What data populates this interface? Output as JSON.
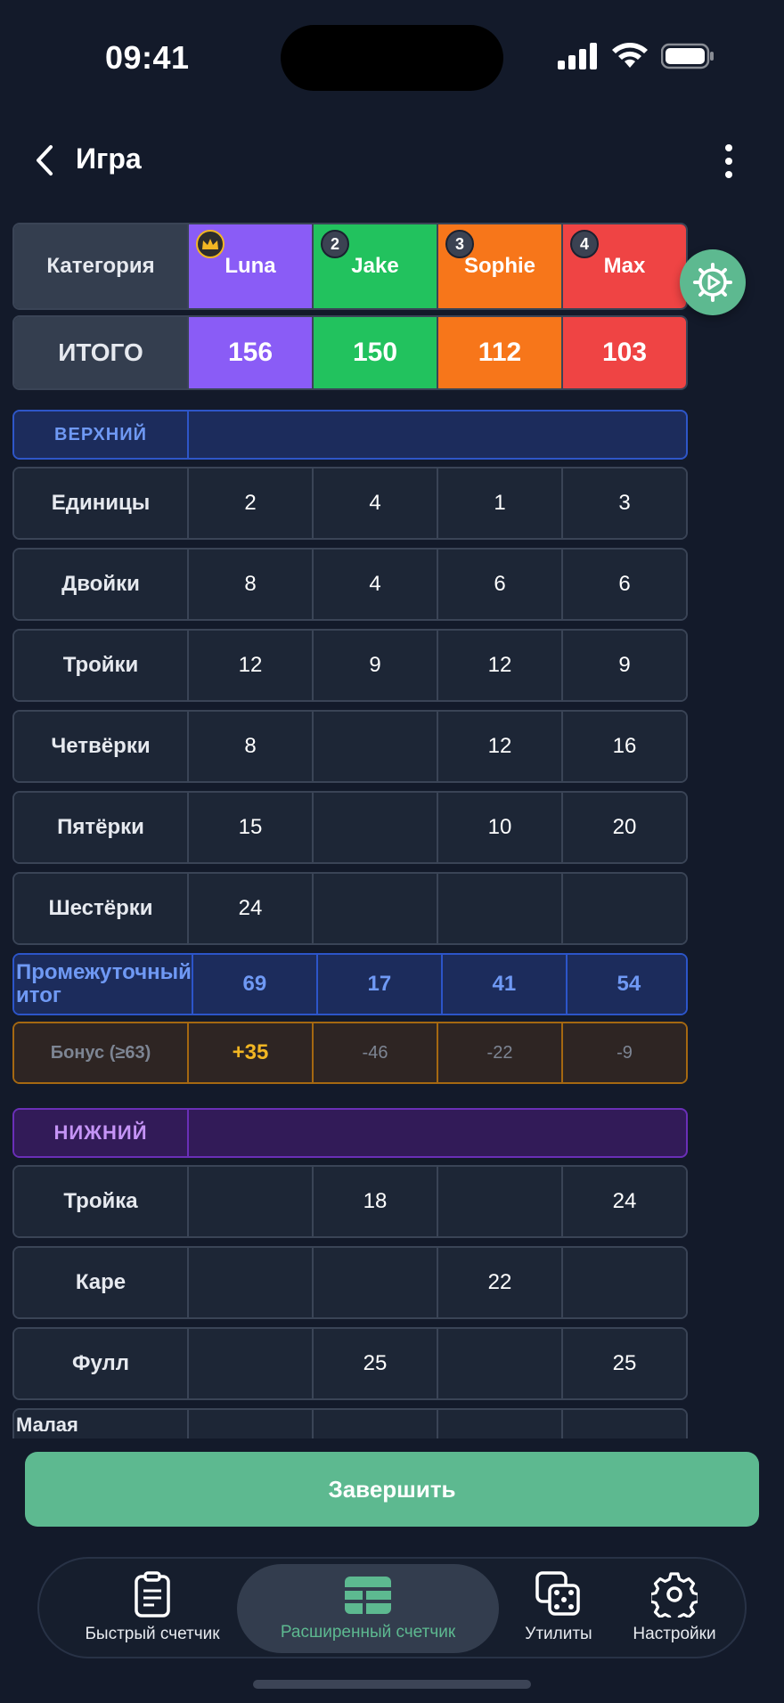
{
  "status_bar": {
    "time": "09:41"
  },
  "header": {
    "title": "Игра"
  },
  "table": {
    "category_header": "Категория",
    "players": [
      {
        "name": "Luna",
        "badge": "crown",
        "color": "#8a5cf6"
      },
      {
        "name": "Jake",
        "badge": "2",
        "color": "#22c25e"
      },
      {
        "name": "Sophie",
        "badge": "3",
        "color": "#f7761a"
      },
      {
        "name": "Max",
        "badge": "4",
        "color": "#ef4444"
      }
    ],
    "total": {
      "label": "ИТОГО",
      "values": [
        "156",
        "150",
        "112",
        "103"
      ]
    },
    "upper_section": {
      "label": "ВЕРХНИЙ"
    },
    "upper_rows": [
      {
        "label": "Единицы",
        "values": [
          "2",
          "4",
          "1",
          "3"
        ]
      },
      {
        "label": "Двойки",
        "values": [
          "8",
          "4",
          "6",
          "6"
        ]
      },
      {
        "label": "Тройки",
        "values": [
          "12",
          "9",
          "12",
          "9"
        ]
      },
      {
        "label": "Четвёрки",
        "values": [
          "8",
          "",
          "12",
          "16"
        ]
      },
      {
        "label": "Пятёрки",
        "values": [
          "15",
          "",
          "10",
          "20"
        ]
      },
      {
        "label": "Шестёрки",
        "values": [
          "24",
          "",
          "",
          ""
        ]
      }
    ],
    "subtotal": {
      "label": "Промежуточный итог",
      "values": [
        "69",
        "17",
        "41",
        "54"
      ]
    },
    "bonus": {
      "label": "Бонус (≥63)",
      "values": [
        "+35",
        "-46",
        "-22",
        "-9"
      ]
    },
    "lower_section": {
      "label": "НИЖНИЙ"
    },
    "lower_rows": [
      {
        "label": "Тройка",
        "values": [
          "",
          "18",
          "",
          "24"
        ]
      },
      {
        "label": "Каре",
        "values": [
          "",
          "",
          "22",
          ""
        ]
      },
      {
        "label": "Фулл",
        "values": [
          "",
          "25",
          "",
          "25"
        ]
      },
      {
        "label": "Малая",
        "values": [
          "",
          "",
          "",
          ""
        ]
      }
    ]
  },
  "finish_button": "Завершить",
  "tabs": [
    {
      "label": "Быстрый счетчик",
      "icon": "clipboard-icon"
    },
    {
      "label": "Расширенный счетчик",
      "icon": "table-icon",
      "active": true
    },
    {
      "label": "Утилиты",
      "icon": "dice-icon"
    },
    {
      "label": "Настройки",
      "icon": "gear-icon"
    }
  ],
  "colors": {
    "accent": "#5db990",
    "background": "#131a2a"
  }
}
